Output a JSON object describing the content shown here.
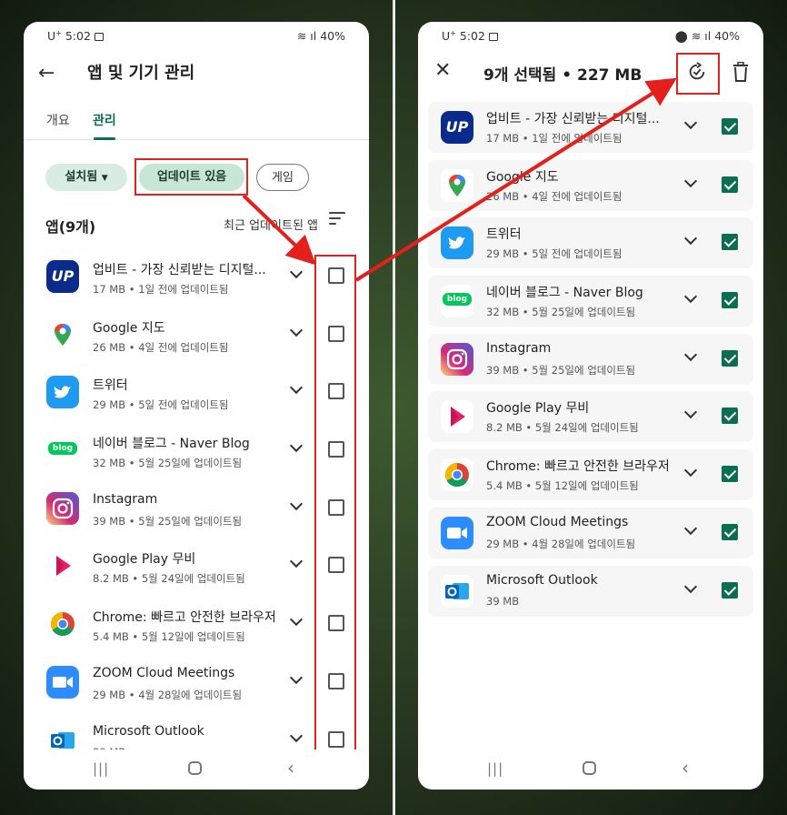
{
  "status_left": {
    "carrier": "U",
    "carrier_sup": "+",
    "time": "5:02"
  },
  "status_right": {
    "left_phone": "40%",
    "right_phone": "40%"
  },
  "left": {
    "title": "앱 및 기기 관리",
    "tabs": [
      "개요",
      "관리"
    ],
    "chips": {
      "installed": "설치됨",
      "update": "업데이트 있음",
      "game": "게임"
    },
    "section_title": "앱(9개)",
    "sort_label": "최근 업데이트된 앱"
  },
  "right": {
    "title": "9개 선택됨  •  227 MB"
  },
  "apps": [
    {
      "name": "업비트 - 가장 신뢰받는 디지털...",
      "name_right": "업비트 - 가장 신뢰받는 디지털...",
      "size": "17 MB",
      "updated": "1일 전에 업데이트됨",
      "icon": "upbit-icon",
      "color": "#0a2b8c",
      "glyph": "UP"
    },
    {
      "name": "Google 지도",
      "name_right": "Google 지도",
      "size": "26 MB",
      "updated": "4일 전에 업데이트됨",
      "icon": "google-maps-icon",
      "color": "#ffffff",
      "glyph": ""
    },
    {
      "name": "트위터",
      "name_right": "트위터",
      "size": "29 MB",
      "updated": "5일 전에 업데이트됨",
      "icon": "twitter-icon",
      "color": "#1d9bf0",
      "glyph": ""
    },
    {
      "name": "네이버 블로그 - Naver Blog",
      "name_right": "네이버 블로그 - Naver Blog",
      "size": "32 MB",
      "updated": "5월 25일에 업데이트됨",
      "icon": "naver-blog-icon",
      "color": "#ffffff",
      "glyph": "blog"
    },
    {
      "name": "Instagram",
      "name_right": "Instagram",
      "size": "39 MB",
      "updated": "5월 25일에 업데이트됨",
      "icon": "instagram-icon",
      "color": "#d62976",
      "glyph": ""
    },
    {
      "name": "Google Play 무비",
      "name_right": "Google Play 무비",
      "size": "8.2 MB",
      "updated": "5월 24일에 업데이트됨",
      "icon": "play-movies-icon",
      "color": "#ffffff",
      "glyph": ""
    },
    {
      "name": "Chrome: 빠르고 안전한 브라우저",
      "name_right": "Chrome: 빠르고 안전한 브라우저",
      "size": "5.4 MB",
      "updated": "5월 12일에 업데이트됨",
      "icon": "chrome-icon",
      "color": "#ffffff",
      "glyph": ""
    },
    {
      "name": "ZOOM Cloud Meetings",
      "name_right": "ZOOM Cloud Meetings",
      "size": "29 MB",
      "updated": "4월 28일에 업데이트됨",
      "icon": "zoom-icon",
      "color": "#2d8cff",
      "glyph": ""
    },
    {
      "name": "Microsoft Outlook",
      "name_right": "Microsoft Outlook",
      "size": "39 MB",
      "updated": "",
      "icon": "outlook-icon",
      "color": "#ffffff",
      "glyph": ""
    }
  ],
  "colors": {
    "accent": "#0b6e4f",
    "annotation": "#e3201b"
  }
}
